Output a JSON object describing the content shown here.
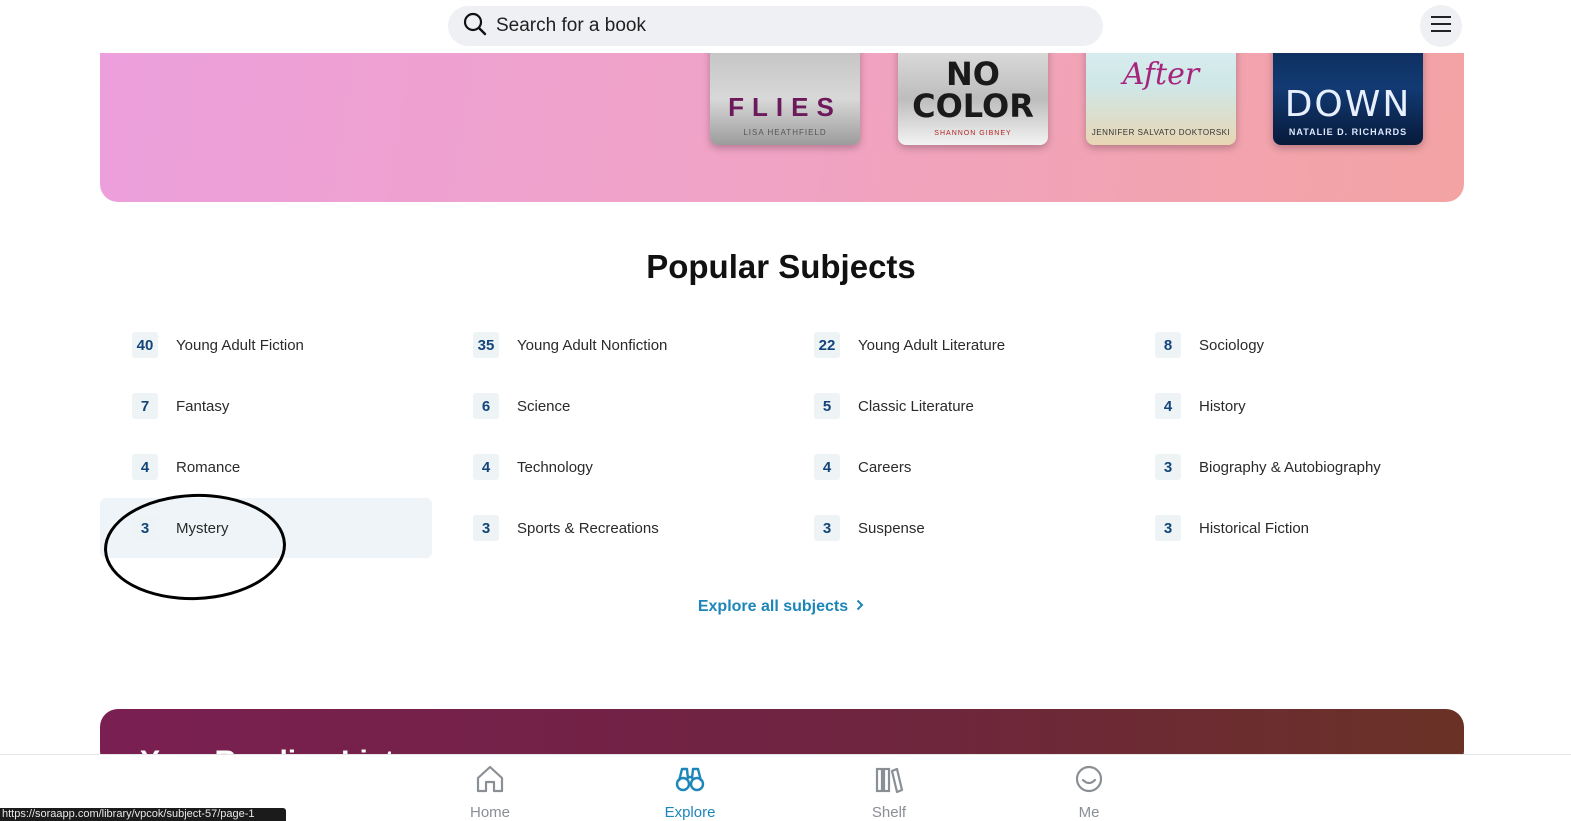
{
  "search": {
    "placeholder": "Search for a book"
  },
  "hero": {
    "covers": [
      {
        "title": "FLIES",
        "author": "LISA HEATHFIELD"
      },
      {
        "title": "NO COLOR",
        "author": "SHANNON GIBNEY"
      },
      {
        "title": "After",
        "author": "JENNIFER SALVATO DOKTORSKI"
      },
      {
        "title": "DOWN",
        "author": "NATALIE D. RICHARDS"
      }
    ]
  },
  "subjects": {
    "title": "Popular Subjects",
    "items": [
      {
        "count": "40",
        "name": "Young Adult Fiction"
      },
      {
        "count": "35",
        "name": "Young Adult Nonfiction"
      },
      {
        "count": "22",
        "name": "Young Adult Literature"
      },
      {
        "count": "8",
        "name": "Sociology"
      },
      {
        "count": "7",
        "name": "Fantasy"
      },
      {
        "count": "6",
        "name": "Science"
      },
      {
        "count": "5",
        "name": "Classic Literature"
      },
      {
        "count": "4",
        "name": "History"
      },
      {
        "count": "4",
        "name": "Romance"
      },
      {
        "count": "4",
        "name": "Technology"
      },
      {
        "count": "4",
        "name": "Careers"
      },
      {
        "count": "3",
        "name": "Biography & Autobiography"
      },
      {
        "count": "3",
        "name": "Mystery"
      },
      {
        "count": "3",
        "name": "Sports & Recreations"
      },
      {
        "count": "3",
        "name": "Suspense"
      },
      {
        "count": "3",
        "name": "Historical Fiction"
      }
    ],
    "explore_all": "Explore all subjects"
  },
  "next_section": {
    "title": "Your Reading Lists"
  },
  "nav": {
    "home": "Home",
    "explore": "Explore",
    "shelf": "Shelf",
    "me": "Me",
    "active": "Explore"
  },
  "status_url": "https://soraapp.com/library/vpcok/subject-57/page-1",
  "colors": {
    "accent": "#1d86b8",
    "count_text": "#12467a"
  }
}
